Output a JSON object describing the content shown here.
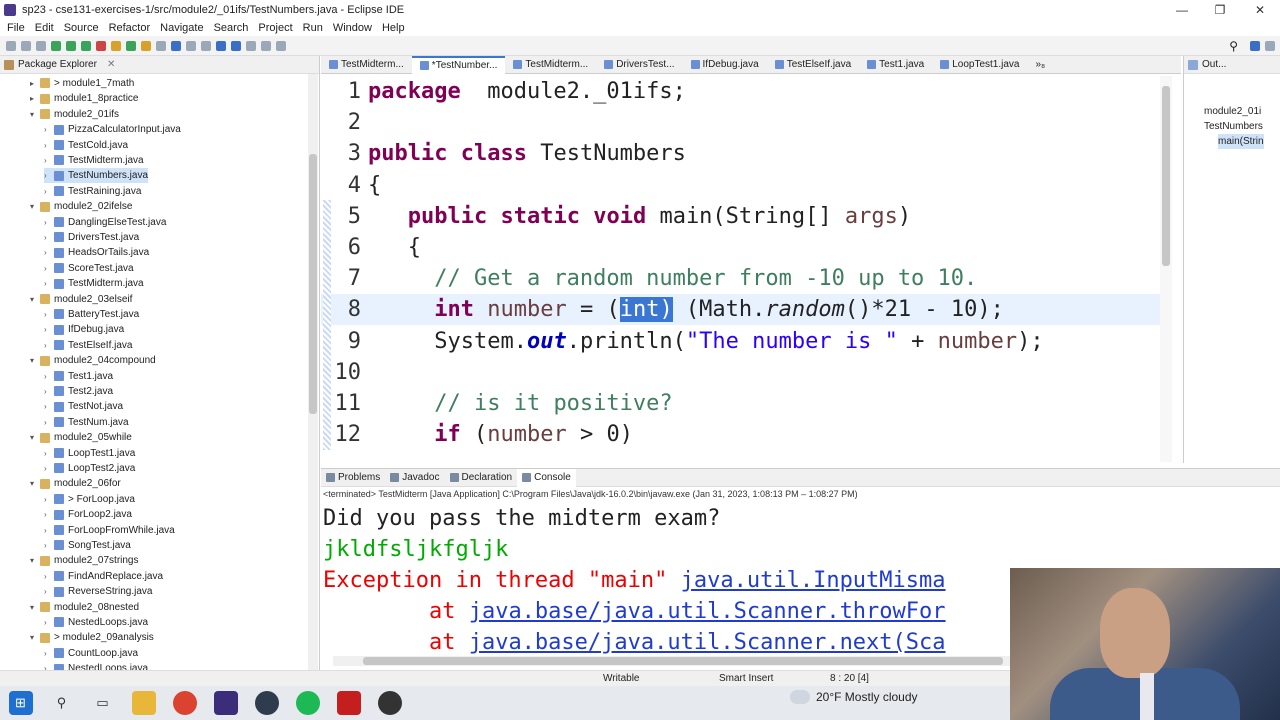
{
  "window": {
    "title": "sp23 - cse131-exercises-1/src/module2/_01ifs/TestNumbers.java - Eclipse IDE"
  },
  "menu": [
    "File",
    "Edit",
    "Source",
    "Refactor",
    "Navigate",
    "Search",
    "Project",
    "Run",
    "Window",
    "Help"
  ],
  "package_explorer": {
    "title": "Package Explorer",
    "items": [
      {
        "label": "> module1_7math",
        "level": 1,
        "type": "package",
        "expanded": false
      },
      {
        "label": "module1_8practice",
        "level": 1,
        "type": "package",
        "expanded": false
      },
      {
        "label": "module2_01ifs",
        "level": 1,
        "type": "package",
        "expanded": true
      },
      {
        "label": "PizzaCalculatorInput.java",
        "level": 2,
        "type": "file"
      },
      {
        "label": "TestCold.java",
        "level": 2,
        "type": "file"
      },
      {
        "label": "TestMidterm.java",
        "level": 2,
        "type": "file"
      },
      {
        "label": "TestNumbers.java",
        "level": 2,
        "type": "file",
        "selected": true
      },
      {
        "label": "TestRaining.java",
        "level": 2,
        "type": "file"
      },
      {
        "label": "module2_02ifelse",
        "level": 1,
        "type": "package",
        "expanded": true
      },
      {
        "label": "DanglingElseTest.java",
        "level": 2,
        "type": "file"
      },
      {
        "label": "DriversTest.java",
        "level": 2,
        "type": "file"
      },
      {
        "label": "HeadsOrTails.java",
        "level": 2,
        "type": "file"
      },
      {
        "label": "ScoreTest.java",
        "level": 2,
        "type": "file"
      },
      {
        "label": "TestMidterm.java",
        "level": 2,
        "type": "file"
      },
      {
        "label": "module2_03elseif",
        "level": 1,
        "type": "package",
        "expanded": true
      },
      {
        "label": "BatteryTest.java",
        "level": 2,
        "type": "file"
      },
      {
        "label": "IfDebug.java",
        "level": 2,
        "type": "file"
      },
      {
        "label": "TestElseIf.java",
        "level": 2,
        "type": "file"
      },
      {
        "label": "module2_04compound",
        "level": 1,
        "type": "package",
        "expanded": true
      },
      {
        "label": "Test1.java",
        "level": 2,
        "type": "file"
      },
      {
        "label": "Test2.java",
        "level": 2,
        "type": "file"
      },
      {
        "label": "TestNot.java",
        "level": 2,
        "type": "file"
      },
      {
        "label": "TestNum.java",
        "level": 2,
        "type": "file"
      },
      {
        "label": "module2_05while",
        "level": 1,
        "type": "package",
        "expanded": true
      },
      {
        "label": "LoopTest1.java",
        "level": 2,
        "type": "file"
      },
      {
        "label": "LoopTest2.java",
        "level": 2,
        "type": "file"
      },
      {
        "label": "module2_06for",
        "level": 1,
        "type": "package",
        "expanded": true
      },
      {
        "label": "> ForLoop.java",
        "level": 2,
        "type": "file"
      },
      {
        "label": "ForLoop2.java",
        "level": 2,
        "type": "file"
      },
      {
        "label": "ForLoopFromWhile.java",
        "level": 2,
        "type": "file"
      },
      {
        "label": "SongTest.java",
        "level": 2,
        "type": "file"
      },
      {
        "label": "module2_07strings",
        "level": 1,
        "type": "package",
        "expanded": true
      },
      {
        "label": "FindAndReplace.java",
        "level": 2,
        "type": "file"
      },
      {
        "label": "ReverseString.java",
        "level": 2,
        "type": "file"
      },
      {
        "label": "module2_08nested",
        "level": 1,
        "type": "package",
        "expanded": true
      },
      {
        "label": "NestedLoops.java",
        "level": 2,
        "type": "file"
      },
      {
        "label": "> module2_09analysis",
        "level": 1,
        "type": "package",
        "expanded": true
      },
      {
        "label": "CountLoop.java",
        "level": 2,
        "type": "file"
      },
      {
        "label": "NestedLoops.java",
        "level": 2,
        "type": "file"
      }
    ]
  },
  "editor": {
    "tabs": [
      {
        "label": "TestMidterm...",
        "active": false
      },
      {
        "label": "*TestNumber...",
        "active": true
      },
      {
        "label": "TestMidterm...",
        "active": false
      },
      {
        "label": "DriversTest...",
        "active": false
      },
      {
        "label": "IfDebug.java",
        "active": false
      },
      {
        "label": "TestElseIf.java",
        "active": false
      },
      {
        "label": "Test1.java",
        "active": false
      },
      {
        "label": "LoopTest1.java",
        "active": false
      },
      {
        "label": "»₈",
        "active": false
      }
    ],
    "lines": [
      {
        "n": "1",
        "tokens": [
          [
            "kw",
            "package"
          ],
          [
            "",
            "  module2._01ifs;"
          ]
        ]
      },
      {
        "n": "2",
        "tokens": []
      },
      {
        "n": "3",
        "tokens": [
          [
            "kw",
            "public"
          ],
          [
            "",
            " "
          ],
          [
            "kw",
            "class"
          ],
          [
            "",
            " TestNumbers"
          ]
        ]
      },
      {
        "n": "4",
        "tokens": [
          [
            "",
            "{"
          ]
        ]
      },
      {
        "n": "5",
        "tokens": [
          [
            "",
            "   "
          ],
          [
            "kw",
            "public"
          ],
          [
            "",
            " "
          ],
          [
            "kw",
            "static"
          ],
          [
            "",
            " "
          ],
          [
            "kw",
            "void"
          ],
          [
            "",
            " main(String[] "
          ],
          [
            "vr",
            "args"
          ],
          [
            "",
            ")"
          ]
        ]
      },
      {
        "n": "6",
        "tokens": [
          [
            "",
            "   {"
          ]
        ]
      },
      {
        "n": "7",
        "tokens": [
          [
            "",
            "     "
          ],
          [
            "cm",
            "// Get a random number from -10 up to 10."
          ]
        ]
      },
      {
        "n": "8",
        "tokens": [
          [
            "",
            "     "
          ],
          [
            "kw",
            "int"
          ],
          [
            "",
            " "
          ],
          [
            "vr",
            "number"
          ],
          [
            "",
            " = ("
          ],
          [
            "hl",
            "int)"
          ],
          [
            "",
            " (Math."
          ],
          [
            "it",
            "random"
          ],
          [
            "",
            "()*21 - 10);"
          ]
        ],
        "current": true
      },
      {
        "n": "9",
        "tokens": [
          [
            "",
            "     System."
          ],
          [
            "fld",
            "out"
          ],
          [
            "",
            ".println("
          ],
          [
            "st",
            "\"The number is \""
          ],
          [
            "",
            " + "
          ],
          [
            "vr",
            "number"
          ],
          [
            "",
            ");"
          ]
        ]
      },
      {
        "n": "10",
        "tokens": []
      },
      {
        "n": "11",
        "tokens": [
          [
            "",
            "     "
          ],
          [
            "cm",
            "// is it positive?"
          ]
        ]
      },
      {
        "n": "12",
        "tokens": [
          [
            "",
            "     "
          ],
          [
            "kw",
            "if"
          ],
          [
            "",
            " ("
          ],
          [
            "vr",
            "number"
          ],
          [
            "",
            " > 0)"
          ]
        ]
      }
    ]
  },
  "outline": {
    "title": "Out...",
    "items": [
      "module2_01i",
      "TestNumbers",
      "main(Strin"
    ]
  },
  "console": {
    "tabs": [
      "Problems",
      "Javadoc",
      "Declaration",
      "Console"
    ],
    "terminated": "<terminated> TestMidterm [Java Application] C:\\Program Files\\Java\\jdk-16.0.2\\bin\\javaw.exe (Jan 31, 2023, 1:08:13 PM – 1:08:27 PM)",
    "prompt": "Did you pass the midterm exam?",
    "input": "jkldfsljkfgljk",
    "exception_prefix": "Exception in thread \"main\" ",
    "exception_link": "java.util.InputMisma",
    "stack1_prefix": "        at ",
    "stack1_link": "java.base/java.util.Scanner.throwFor",
    "stack2_prefix": "        at ",
    "stack2_link": "java.base/java.util.Scanner.next(Sca"
  },
  "status": {
    "writable": "Writable",
    "insert": "Smart Insert",
    "position": "8 : 20 [4]"
  },
  "taskbar": {
    "weather": "20°F  Mostly cloudy"
  }
}
